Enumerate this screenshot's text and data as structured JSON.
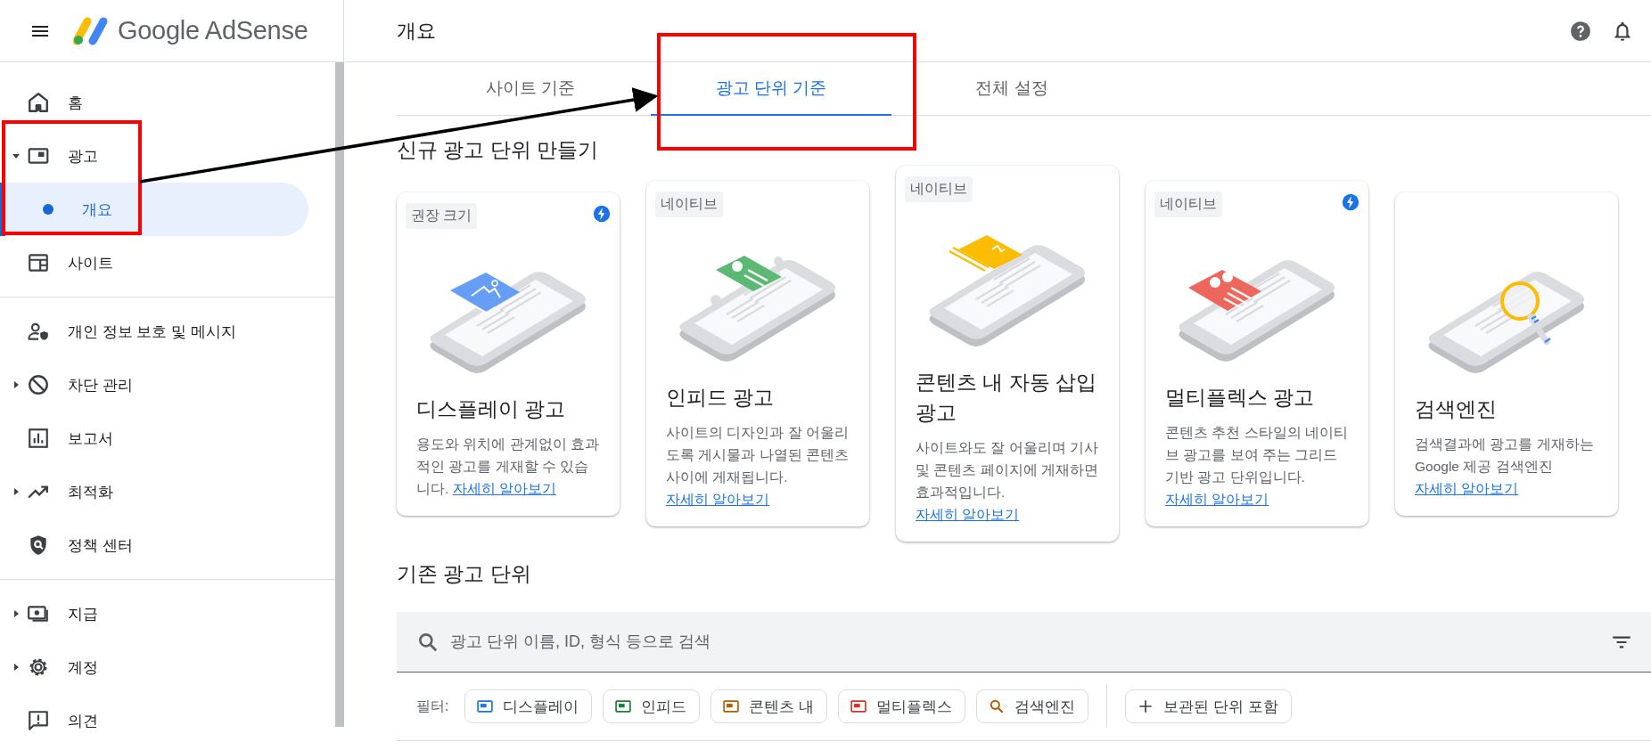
{
  "header": {
    "product": "Google AdSense",
    "page_title": "개요"
  },
  "sidebar": {
    "sections": [
      [
        {
          "label": "홈",
          "selected": false
        },
        {
          "label": "광고",
          "selected": false,
          "expanded": true,
          "children": [
            {
              "label": "개요",
              "selected": true
            }
          ]
        },
        {
          "label": "사이트",
          "selected": false
        }
      ],
      [
        {
          "label": "개인 정보 보호 및 메시지",
          "selected": false
        },
        {
          "label": "차단 관리",
          "selected": false,
          "expanded": false
        },
        {
          "label": "보고서",
          "selected": false
        },
        {
          "label": "최적화",
          "selected": false,
          "expanded": false
        },
        {
          "label": "정책 센터",
          "selected": false
        }
      ],
      [
        {
          "label": "지급",
          "selected": false,
          "expanded": false
        },
        {
          "label": "계정",
          "selected": false,
          "expanded": false
        },
        {
          "label": "의견",
          "selected": false
        }
      ]
    ]
  },
  "tabs": [
    {
      "label": "사이트 기준",
      "selected": false
    },
    {
      "label": "광고 단위 기준",
      "selected": true
    },
    {
      "label": "전체 설정",
      "selected": false
    }
  ],
  "create_section": {
    "heading": "신규 광고 단위 만들기",
    "cards": [
      {
        "badge": "권장 크기",
        "bolt": true,
        "title": "디스플레이 광고",
        "description": "용도와 위치에 관계없이 효과적인 광고를 게재할 수 있습니다. ",
        "link": "자세히 알아보기"
      },
      {
        "badge": "네이티브",
        "bolt": false,
        "title": "인피드 광고",
        "description": "사이트의 디자인과 잘 어울리도록 게시물과 나열된 콘텐츠 사이에 게재됩니다. ",
        "link": "자세히 알아보기"
      },
      {
        "badge": "네이티브",
        "bolt": false,
        "title": "콘텐츠 내 자동 삽입 광고",
        "description": "사이트와도 잘 어울리며 기사 및 콘텐츠 페이지에 게재하면 효과적입니다. ",
        "link": "자세히 알아보기"
      },
      {
        "badge": "네이티브",
        "bolt": true,
        "title": "멀티플렉스 광고",
        "description": "콘텐츠 추천 스타일의 네이티브 광고를 보여 주는 그리드 기반 광고 단위입니다. ",
        "link": "자세히 알아보기"
      },
      {
        "bolt": false,
        "title": "검색엔진",
        "description": "검색결과에 광고를 게재하는 Google 제공 검색엔진 ",
        "link": "자세히 알아보기"
      }
    ]
  },
  "existing_section": {
    "heading": "기존 광고 단위",
    "search": {
      "placeholder": "광고 단위 이름, ID, 형식 등으로 검색"
    },
    "filter_label": "필터:",
    "filters": [
      {
        "label": "디스플레이",
        "kind": "format",
        "color": "#1a73e8"
      },
      {
        "label": "인피드",
        "kind": "format",
        "color": "#188038"
      },
      {
        "label": "콘텐츠 내",
        "kind": "format",
        "color": "#b06000"
      },
      {
        "label": "멀티플렉스",
        "kind": "format",
        "color": "#d93025"
      },
      {
        "label": "검색엔진",
        "kind": "search",
        "color": "#b06000"
      }
    ],
    "archived_button": "보관된 단위 포함"
  }
}
